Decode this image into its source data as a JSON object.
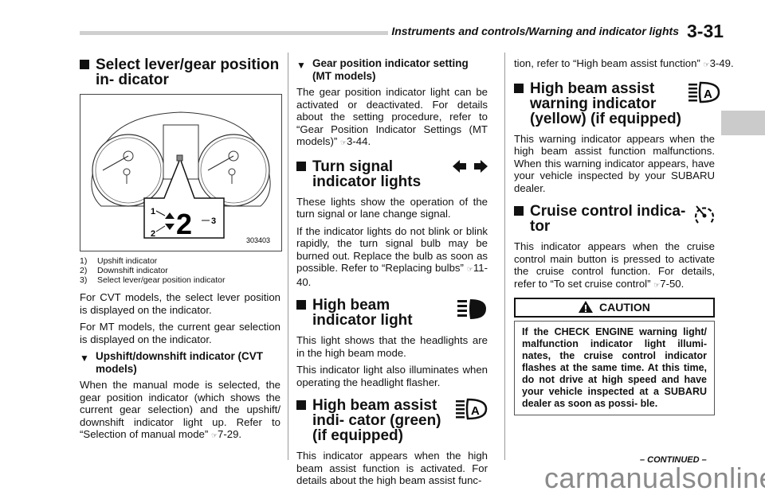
{
  "header": {
    "section_title": "Instruments and controls/Warning and indicator lights",
    "page_number": "3-31"
  },
  "column1": {
    "heading": "Select lever/gear position in- dicator",
    "figure": {
      "id": "303403",
      "callouts": [
        "1",
        "2",
        "3"
      ],
      "gear_value": "2"
    },
    "figure_legend": [
      {
        "num": "1)",
        "text": "Upshift indicator"
      },
      {
        "num": "2)",
        "text": "Downshift indicator"
      },
      {
        "num": "3)",
        "text": "Select lever/gear position indicator"
      }
    ],
    "para1": "For CVT models, the select lever position is displayed on the indicator.",
    "para2": "For MT models, the current gear selection is displayed on the indicator.",
    "subheading": "Upshift/downshift indicator (CVT models)",
    "para3": "When the manual mode is selected, the gear position indicator (which shows the current gear selection) and the upshift/ downshift indicator light up. Refer to “Selection of manual mode”",
    "para3_ref": "7-29."
  },
  "column2": {
    "subheading": "Gear position indicator setting (MT models)",
    "para1": "The gear position indicator light can be activated or deactivated. For details about the setting procedure, refer to “Gear Position Indicator Settings (MT models)”",
    "para1_ref": "3-44.",
    "turn_heading": "Turn signal indicator lights",
    "turn_para1": "These lights show the operation of the turn signal or lane change signal.",
    "turn_para2": "If the indicator lights do not blink or blink rapidly, the turn signal bulb may be burned out. Replace the bulb as soon as possible. Refer to “Replacing bulbs”",
    "turn_para2_ref": "11-40.",
    "hb_heading": "High beam indicator light",
    "hb_para1": "This light shows that the headlights are in the high beam mode.",
    "hb_para2": "This indicator light also illuminates when operating the headlight flasher.",
    "hba_heading": "High beam assist indi- cator (green) (if equipped)",
    "hba_para": "This indicator appears when the high beam assist function is activated. For details about the high beam assist func-"
  },
  "column3": {
    "cont_para": "tion, refer to “High beam assist function”",
    "cont_ref": "3-49.",
    "hbaw_heading": "High beam assist warning indicator (yellow) (if equipped)",
    "hbaw_para": "This warning indicator appears when the high beam assist function malfunctions. When this warning indicator appears, have your vehicle inspected by your SUBARU dealer.",
    "cruise_heading": "Cruise control indica- tor",
    "cruise_para": "This indicator appears when the cruise control main button is pressed to activate the cruise control function. For details, refer to “To set cruise control”",
    "cruise_ref": "7-50.",
    "caution_title": "CAUTION",
    "caution_text": "If the CHECK ENGINE warning light/ malfunction indicator light illumi- nates, the cruise control indicator flashes at the same time. At this time, do not drive at high speed and have your vehicle inspected at a SUBARU dealer as soon as possi- ble."
  },
  "footer": {
    "continued": "– CONTINUED –",
    "watermark": "carmanualsonline.info"
  },
  "icons": {
    "ref": "☞",
    "square_bullet": "■",
    "triangle_bullet": "▼"
  }
}
